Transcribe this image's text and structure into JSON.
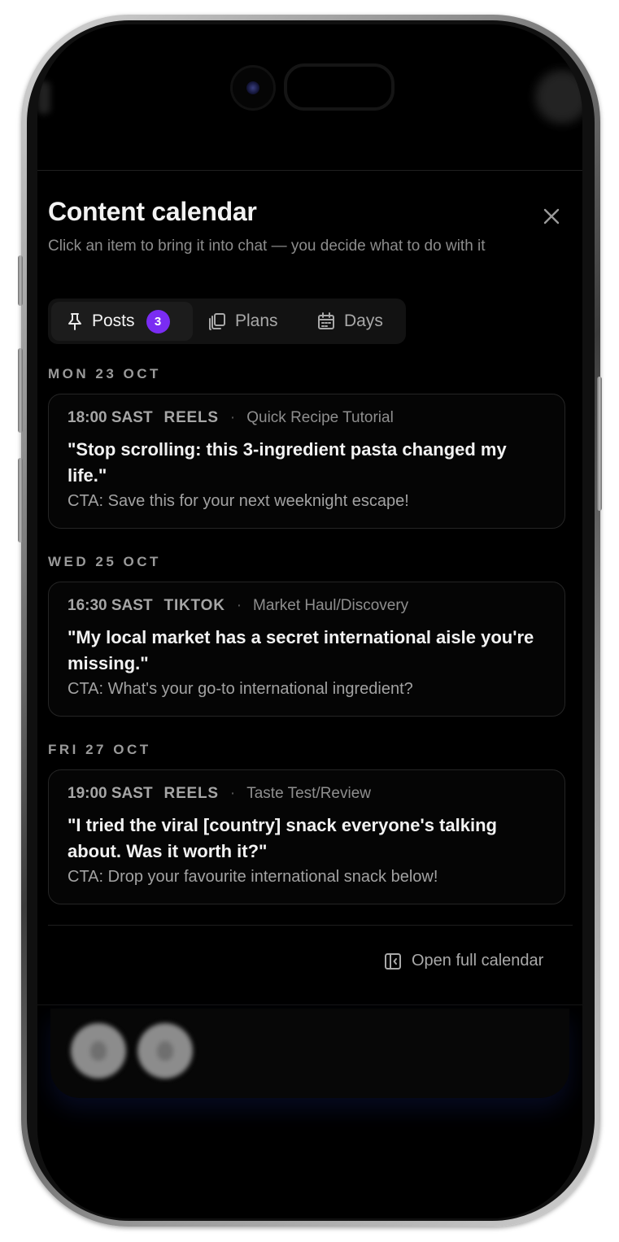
{
  "panel": {
    "title": "Content calendar",
    "subtitle": "Click an item to bring it into chat — you decide what to do with it"
  },
  "tabs": [
    {
      "label": "Posts",
      "icon": "pin-icon",
      "badge": "3",
      "active": true
    },
    {
      "label": "Plans",
      "icon": "copy-stack-icon",
      "active": false
    },
    {
      "label": "Days",
      "icon": "calendar-icon",
      "active": false
    }
  ],
  "days": [
    {
      "label": "MON 23 OCT",
      "post": {
        "time": "18:00 SAST",
        "platform": "REELS",
        "separator": "·",
        "type": "Quick Recipe Tutorial",
        "hook": "\"Stop scrolling: this 3-ingredient pasta changed my life.\"",
        "cta": "CTA: Save this for your next weeknight escape!"
      }
    },
    {
      "label": "WED 25 OCT",
      "post": {
        "time": "16:30 SAST",
        "platform": "TIKTOK",
        "separator": "·",
        "type": "Market Haul/Discovery",
        "hook": "\"My local market has a secret international aisle you're missing.\"",
        "cta": "CTA: What's your go-to international ingredient?"
      }
    },
    {
      "label": "FRI 27 OCT",
      "post": {
        "time": "19:00 SAST",
        "platform": "REELS",
        "separator": "·",
        "type": "Taste Test/Review",
        "hook": "\"I tried the viral [country] snack everyone's talking about. Was it worth it?\"",
        "cta": "CTA: Drop your favourite international snack below!"
      }
    }
  ],
  "footer": {
    "open_calendar_label": "Open full calendar",
    "open_calendar_icon": "sidebar-panel-icon"
  },
  "colors": {
    "background": "#000000",
    "accent_badge": "#7a2cf3",
    "card_border": "#252525",
    "text_primary": "#f2f2f2",
    "text_secondary": "#9a9a9a"
  }
}
